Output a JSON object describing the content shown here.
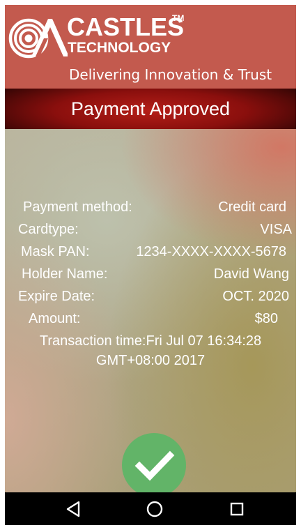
{
  "header": {
    "brand_name": "CASTLES",
    "brand_trademark": "TM",
    "brand_subtitle": "TECHNOLOGY",
    "tagline": "Delivering Innovation & Trust",
    "logo_icon": "castles-logo-icon"
  },
  "status": {
    "text": "Payment Approved"
  },
  "details": {
    "payment_method": {
      "label": "Payment method:",
      "value": "Credit card"
    },
    "card_type": {
      "label": "Cardtype:",
      "value": "VISA"
    },
    "mask_pan": {
      "label": "Mask PAN:",
      "value": "1234-XXXX-XXXX-5678"
    },
    "holder_name": {
      "label": "Holder Name:",
      "value": "David Wang"
    },
    "expire_date": {
      "label": "Expire Date:",
      "value": "OCT. 2020"
    },
    "amount": {
      "label": "Amount:",
      "value": "$80"
    },
    "transaction_time": {
      "line1": "Transaction time:Fri Jul 07 16:34:28",
      "line2": "GMT+08:00 2017"
    }
  },
  "confirm_button": {
    "icon": "checkmark-icon"
  },
  "nav": {
    "back_icon": "back-triangle-icon",
    "home_icon": "home-circle-icon",
    "recents_icon": "recents-square-icon"
  },
  "colors": {
    "header_bg": "#c35a4e",
    "status_bg": "#8a0f0d",
    "confirm_green": "#62b468",
    "nav_bg": "#000000"
  }
}
